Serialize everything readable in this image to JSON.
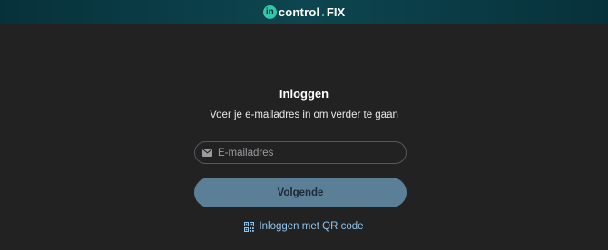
{
  "header": {
    "logo_badge": "in",
    "logo_word": "control",
    "logo_dot": ".",
    "logo_fix": "FIX"
  },
  "login": {
    "title": "Inloggen",
    "subtitle": "Voer je e-mailadres in om verder te gaan",
    "email": {
      "placeholder": "E-mailadres",
      "value": "",
      "icon": "mail-icon"
    },
    "next_label": "Volgende",
    "qr_link_label": "Inloggen met QR code",
    "qr_icon": "qr-code-icon"
  },
  "colors": {
    "background": "#222223",
    "header": "#0d4650",
    "brand_accent": "#34c6a8",
    "button": "#5c7f98",
    "link": "#8fc5ee"
  }
}
